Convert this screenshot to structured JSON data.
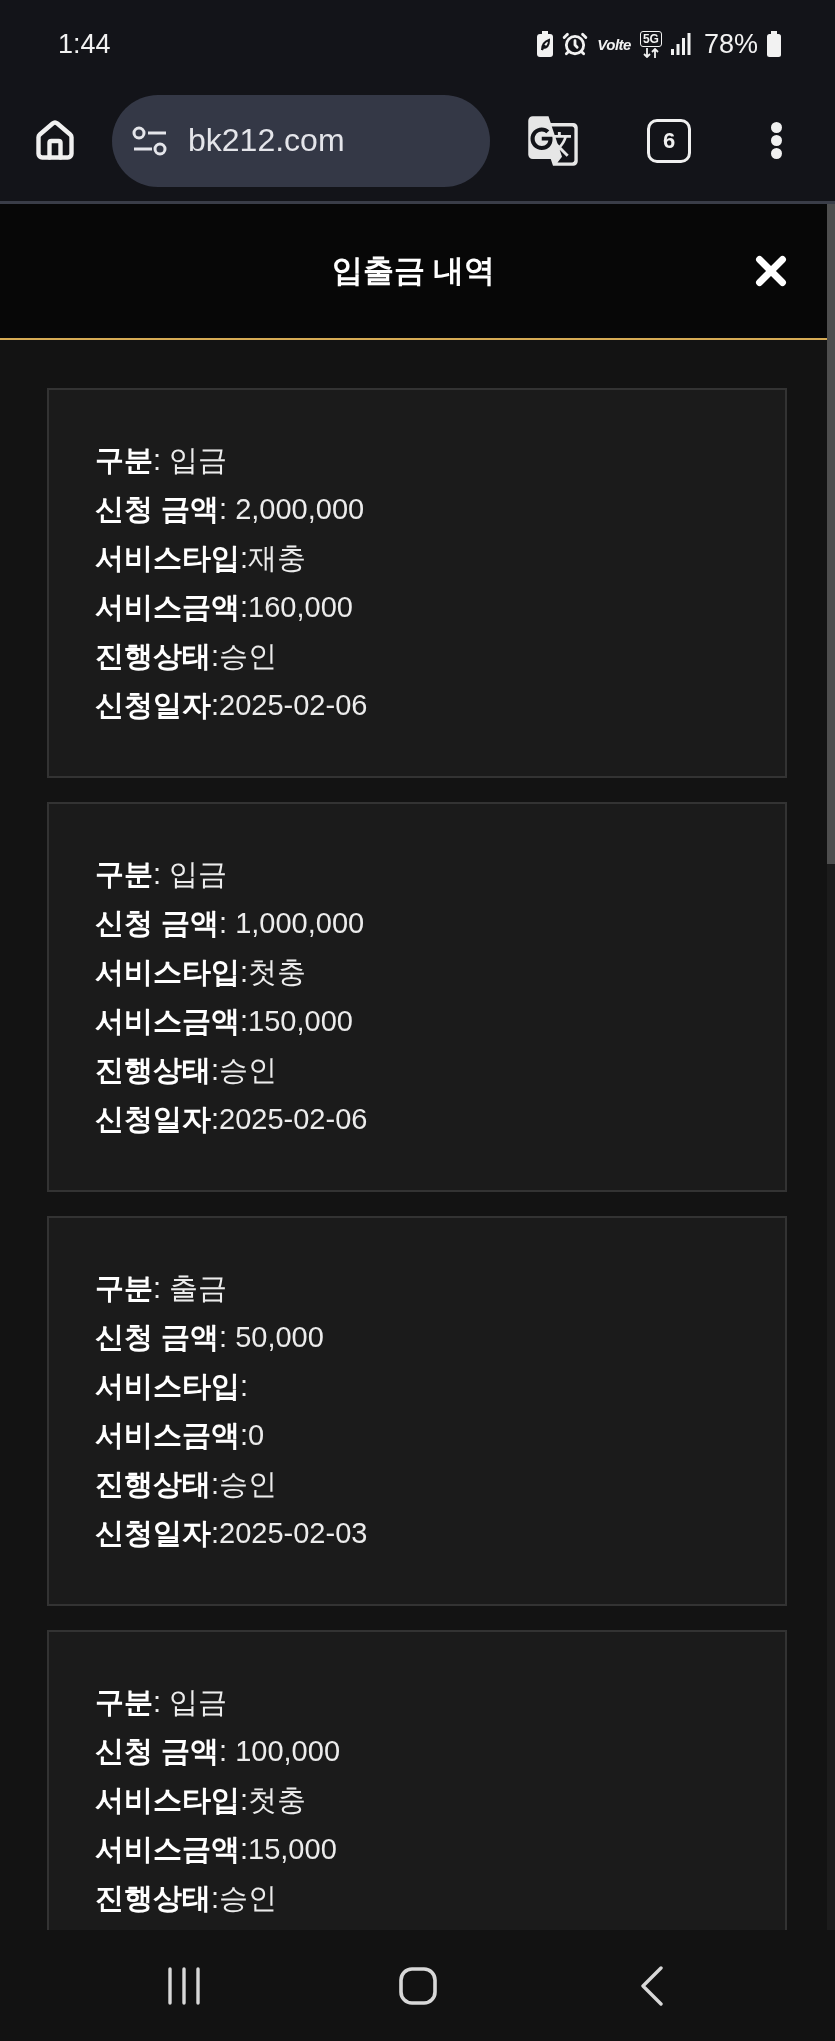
{
  "status_bar": {
    "time": "1:44",
    "volte": "Volte",
    "network": "5G",
    "battery": "78%"
  },
  "browser": {
    "url": "bk212.com",
    "tab_count": "6"
  },
  "modal": {
    "title": "입출금 내역"
  },
  "transactions": [
    {
      "lines": [
        "**구분**: 입금",
        "**신청 금액**: 2,000,000",
        "**서비스타입**:재충",
        "**서비스금액**:160,000",
        "**진행상태**:승인",
        "**신청일자**:2025-02-06"
      ]
    },
    {
      "lines": [
        "**구분**: 입금",
        "**신청 금액**: 1,000,000",
        "**서비스타입**:첫충",
        "**서비스금액**:150,000",
        "**진행상태**:승인",
        "**신청일자**:2025-02-06"
      ]
    },
    {
      "lines": [
        "**구분**: 출금",
        "**신청 금액**: 50,000",
        "**서비스타입**:",
        "**서비스금액**:0",
        "**진행상태**:승인",
        "**신청일자**:2025-02-03"
      ]
    },
    {
      "lines": [
        "**구분**: 입금",
        "**신청 금액**: 100,000",
        "**서비스타입**:첫충",
        "**서비스금액**:15,000",
        "**진행상태**:승인"
      ]
    }
  ]
}
